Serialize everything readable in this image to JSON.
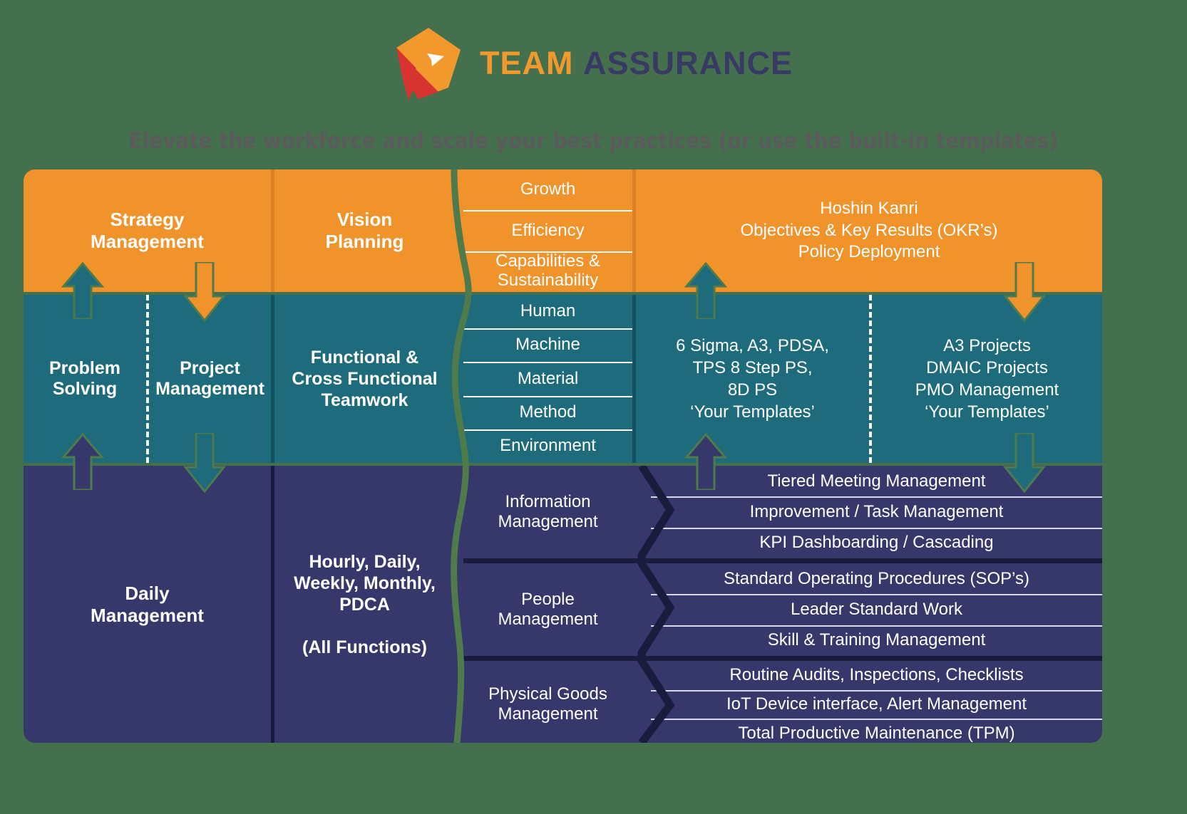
{
  "logo": {
    "mark_name": "teamassurance-pin-logo",
    "word_one": "TEAM",
    "word_two": "ASSURANCE",
    "orange": "#f1992d",
    "red": "#d8332f",
    "navy": "#393a64"
  },
  "headline": "Elevate the workforce and scale your best practices (or use the built-in templates)",
  "rows": {
    "strategy": {
      "col1": "Strategy\nManagement",
      "col2": "Vision\nPlanning",
      "substack": [
        "Growth",
        "Efficiency",
        "Capabilities &\nSustainability"
      ],
      "col4": "Hoshin Kanri\nObjectives & Key Results (OKR’s)\nPolicy Deployment",
      "bg": "#f0932b"
    },
    "problem": {
      "col1a": "Problem\nSolving",
      "col1b": "Project\nManagement",
      "col2": "Functional &\nCross Functional\nTeamwork",
      "substack": [
        "Human",
        "Machine",
        "Material",
        "Method",
        "Environment"
      ],
      "col4a": "6 Sigma, A3, PDSA,\nTPS 8 Step PS,\n8D PS\n‘Your Templates’",
      "col4b": "A3 Projects\nDMAIC Projects\nPMO Management\n‘Your Templates’",
      "bg": "#1e6b7b"
    },
    "daily": {
      "col1": "Daily\nManagement",
      "col2": "Hourly, Daily,\nWeekly, Monthly,\nPDCA\n\n(All Functions)",
      "groups": [
        {
          "label": "Information\nManagement",
          "items": [
            "Tiered Meeting Management",
            "Improvement / Task Management",
            "KPI Dashboarding / Cascading"
          ]
        },
        {
          "label": "People\nManagement",
          "items": [
            "Standard Operating Procedures (SOP’s)",
            "Leader Standard Work",
            "Skill & Training Management"
          ]
        },
        {
          "label": "Physical Goods\nManagement",
          "items": [
            "Routine Audits, Inspections, Checklists",
            "IoT Device interface, Alert Management",
            "Total Productive Maintenance (TPM)"
          ]
        }
      ],
      "bg": "#36376a"
    }
  },
  "colors": {
    "background": "#44704e",
    "orange": "#f0932b",
    "teal": "#1e6b7b",
    "navy": "#36376a",
    "navy_dark": "#1b1c3d",
    "headline_text": "#5b5b5b",
    "divider_white": "#ffffff"
  },
  "arrows": [
    {
      "name": "arrow-up-problem-to-strategy",
      "direction": "up",
      "color": "#1e6b7b"
    },
    {
      "name": "arrow-down-strategy-to-project",
      "direction": "down",
      "color": "#f0932b"
    },
    {
      "name": "arrow-up-templates-to-strategy",
      "direction": "up",
      "color": "#1e6b7b"
    },
    {
      "name": "arrow-down-strategy-to-a3projects",
      "direction": "down",
      "color": "#f0932b"
    },
    {
      "name": "arrow-up-daily-to-problem",
      "direction": "up",
      "color": "#36376a"
    },
    {
      "name": "arrow-down-problem-to-daily",
      "direction": "down",
      "color": "#1e6b7b"
    },
    {
      "name": "arrow-up-daily-to-templates",
      "direction": "up",
      "color": "#36376a"
    },
    {
      "name": "arrow-down-a3projects-to-daily",
      "direction": "down",
      "color": "#1e6b7b"
    }
  ]
}
